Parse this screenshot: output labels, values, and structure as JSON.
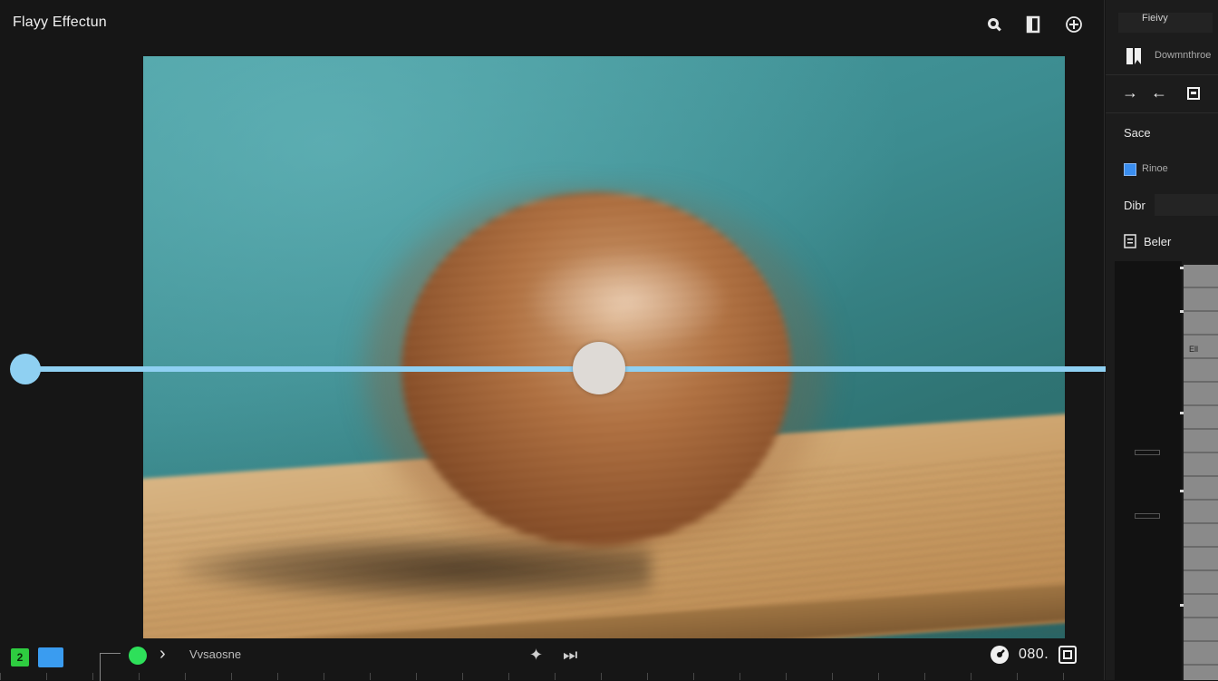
{
  "app": {
    "title": "Flayy Effectun"
  },
  "toolbar": {
    "icons": [
      "zoom-icon",
      "layers-icon",
      "add-circle-icon"
    ]
  },
  "overlay": {
    "type": "motion-vector",
    "color": "#8fd0f2",
    "handle_color": "#dedad6"
  },
  "bottom_bar": {
    "badge": "2",
    "label": "Vvsaosne",
    "value": "080.",
    "badge_color": "#2ecc40",
    "accent_color": "#3a9cf0"
  },
  "panel": {
    "title": "Fieivy",
    "subtitle": "Dowmnthroe",
    "section_1": "Sace",
    "checkbox_label": "Rinoe",
    "section_2": "Dibr",
    "section_3": "Beler",
    "slider_label": "Ell"
  }
}
